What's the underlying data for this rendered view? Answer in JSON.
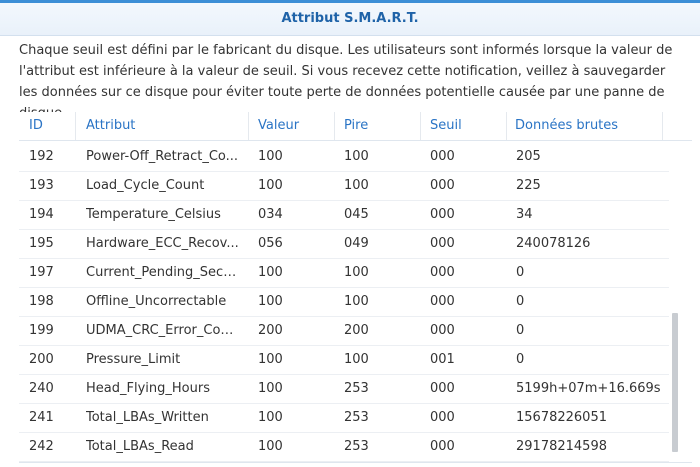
{
  "dialog": {
    "title": "Attribut S.M.A.R.T.",
    "description": "Chaque seuil est défini par le fabricant du disque. Les utilisateurs sont informés lorsque la valeur de l'attribut est inférieure à la valeur de seuil. Si vous recevez cette notification, veillez à sauvegarder les données sur ce disque pour éviter toute perte de données potentielle causée par une panne de disque."
  },
  "table": {
    "columns": {
      "id": "ID",
      "attr": "Attribut",
      "val": "Valeur",
      "pire": "Pire",
      "seuil": "Seuil",
      "raw": "Données brutes"
    },
    "rows": [
      {
        "id": "192",
        "attr": "Power-Off_Retract_Co...",
        "val": "100",
        "pire": "100",
        "seuil": "000",
        "raw": "205"
      },
      {
        "id": "193",
        "attr": "Load_Cycle_Count",
        "val": "100",
        "pire": "100",
        "seuil": "000",
        "raw": "225"
      },
      {
        "id": "194",
        "attr": "Temperature_Celsius",
        "val": "034",
        "pire": "045",
        "seuil": "000",
        "raw": "34"
      },
      {
        "id": "195",
        "attr": "Hardware_ECC_Recov...",
        "val": "056",
        "pire": "049",
        "seuil": "000",
        "raw": "240078126"
      },
      {
        "id": "197",
        "attr": "Current_Pending_Sect...",
        "val": "100",
        "pire": "100",
        "seuil": "000",
        "raw": "0"
      },
      {
        "id": "198",
        "attr": "Offline_Uncorrectable",
        "val": "100",
        "pire": "100",
        "seuil": "000",
        "raw": "0"
      },
      {
        "id": "199",
        "attr": "UDMA_CRC_Error_Cou...",
        "val": "200",
        "pire": "200",
        "seuil": "000",
        "raw": "0"
      },
      {
        "id": "200",
        "attr": "Pressure_Limit",
        "val": "100",
        "pire": "100",
        "seuil": "001",
        "raw": "0"
      },
      {
        "id": "240",
        "attr": "Head_Flying_Hours",
        "val": "100",
        "pire": "253",
        "seuil": "000",
        "raw": "5199h+07m+16.669s"
      },
      {
        "id": "241",
        "attr": "Total_LBAs_Written",
        "val": "100",
        "pire": "253",
        "seuil": "000",
        "raw": "15678226051"
      },
      {
        "id": "242",
        "attr": "Total_LBAs_Read",
        "val": "100",
        "pire": "253",
        "seuil": "000",
        "raw": "29178214598"
      }
    ]
  }
}
